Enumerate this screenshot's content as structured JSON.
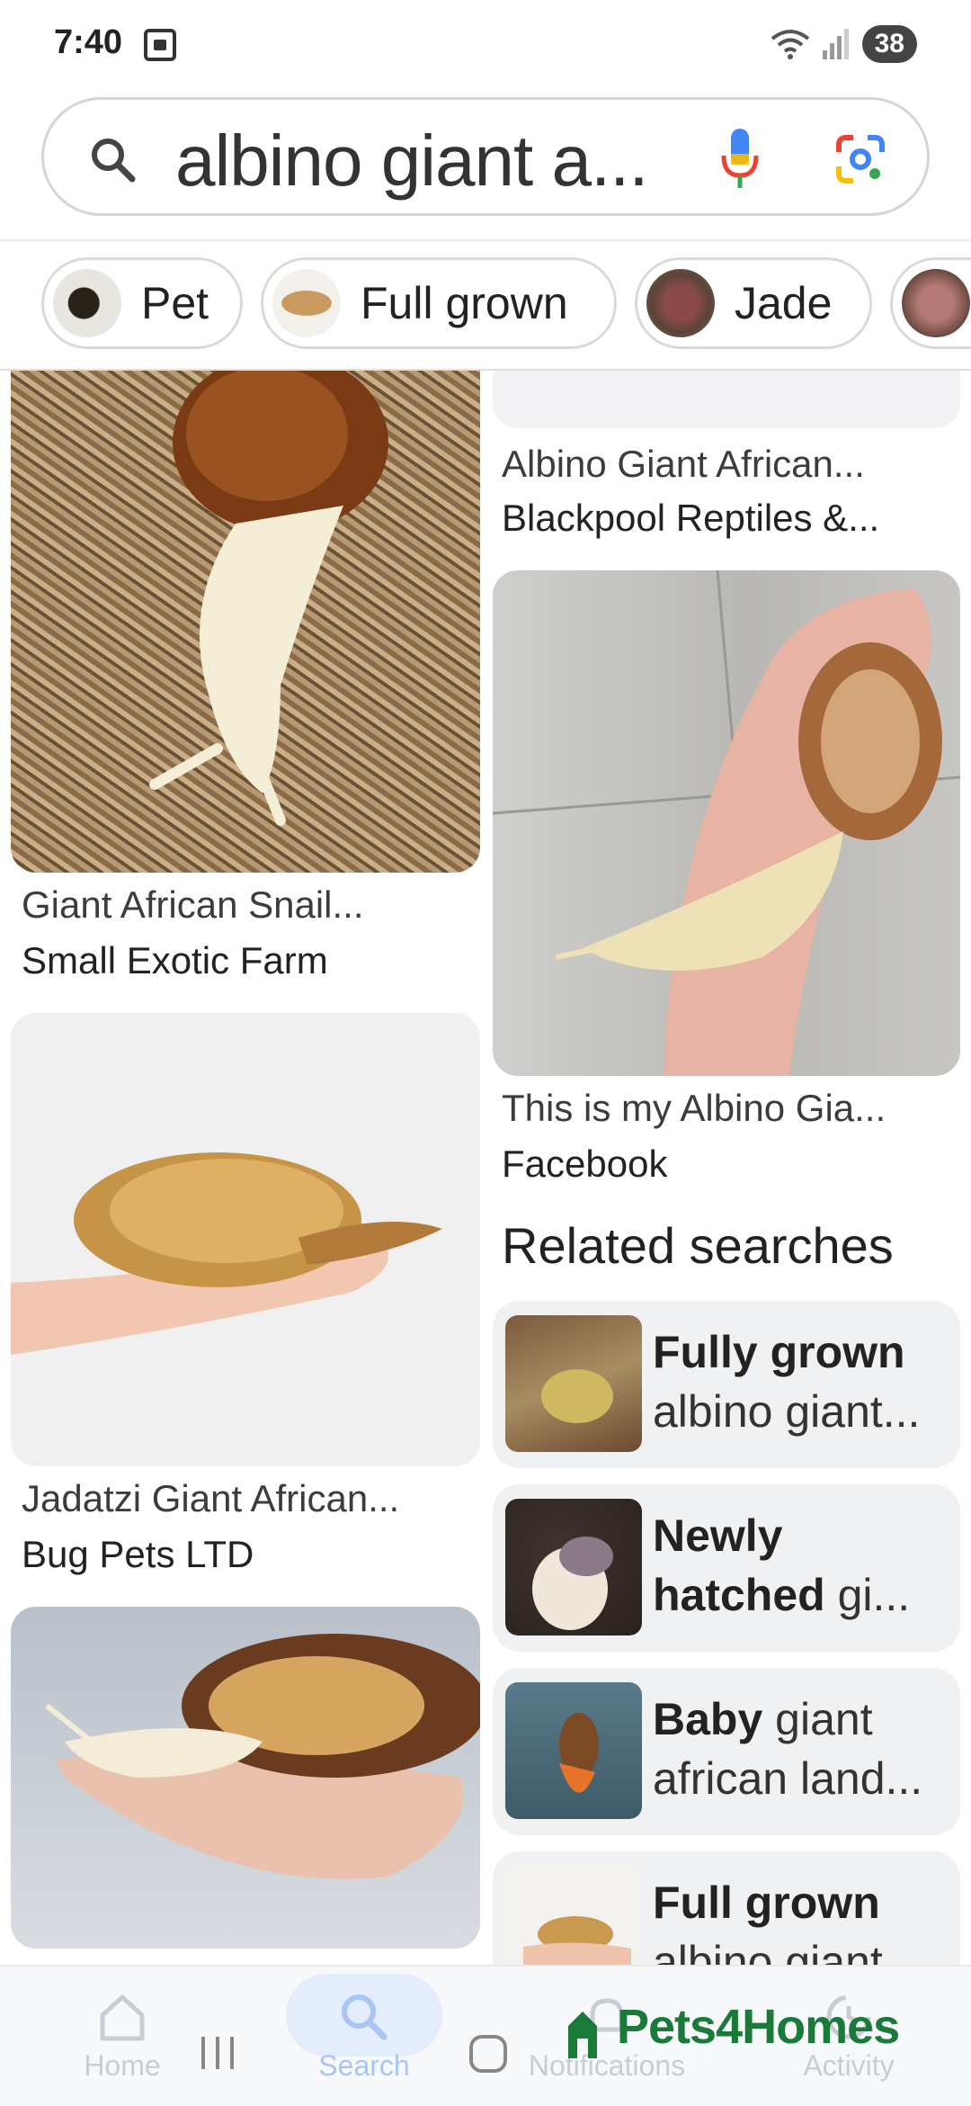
{
  "status_bar": {
    "time": "7:40",
    "battery": "38"
  },
  "search": {
    "query": "albino giant a..."
  },
  "chips": [
    {
      "label": "Pet"
    },
    {
      "label": "Full grown"
    },
    {
      "label": "Jade"
    }
  ],
  "results": [
    {
      "title": "Albino Giant African...",
      "source": "Blackpool Reptiles &..."
    },
    {
      "title": "Giant African Snail...",
      "source": "Small Exotic Farm"
    },
    {
      "title": "This is my Albino Gia...",
      "source": "Facebook"
    },
    {
      "title": "Jadatzi Giant African...",
      "source": "Bug Pets LTD"
    }
  ],
  "related": {
    "heading": "Related searches",
    "items": [
      {
        "bold": "Fully grown",
        "rest": "albino giant..."
      },
      {
        "bold": "Newly hatched",
        "rest": "gi..."
      },
      {
        "bold": "Baby",
        "rest": "giant african land..."
      },
      {
        "bold": "Full grown",
        "rest": "albino giant"
      }
    ]
  },
  "bottom_nav": [
    {
      "label": "Home",
      "icon": "home-icon"
    },
    {
      "label": "Search",
      "icon": "search-icon"
    },
    {
      "label": "Notifications",
      "icon": "bell-icon"
    },
    {
      "label": "Activity",
      "icon": "history-icon"
    }
  ],
  "watermark": "Pets4Homes",
  "colors": {
    "accent": "#4285f4",
    "nav_label": "#c9ccd2",
    "related_bg": "#f0f1f3"
  }
}
